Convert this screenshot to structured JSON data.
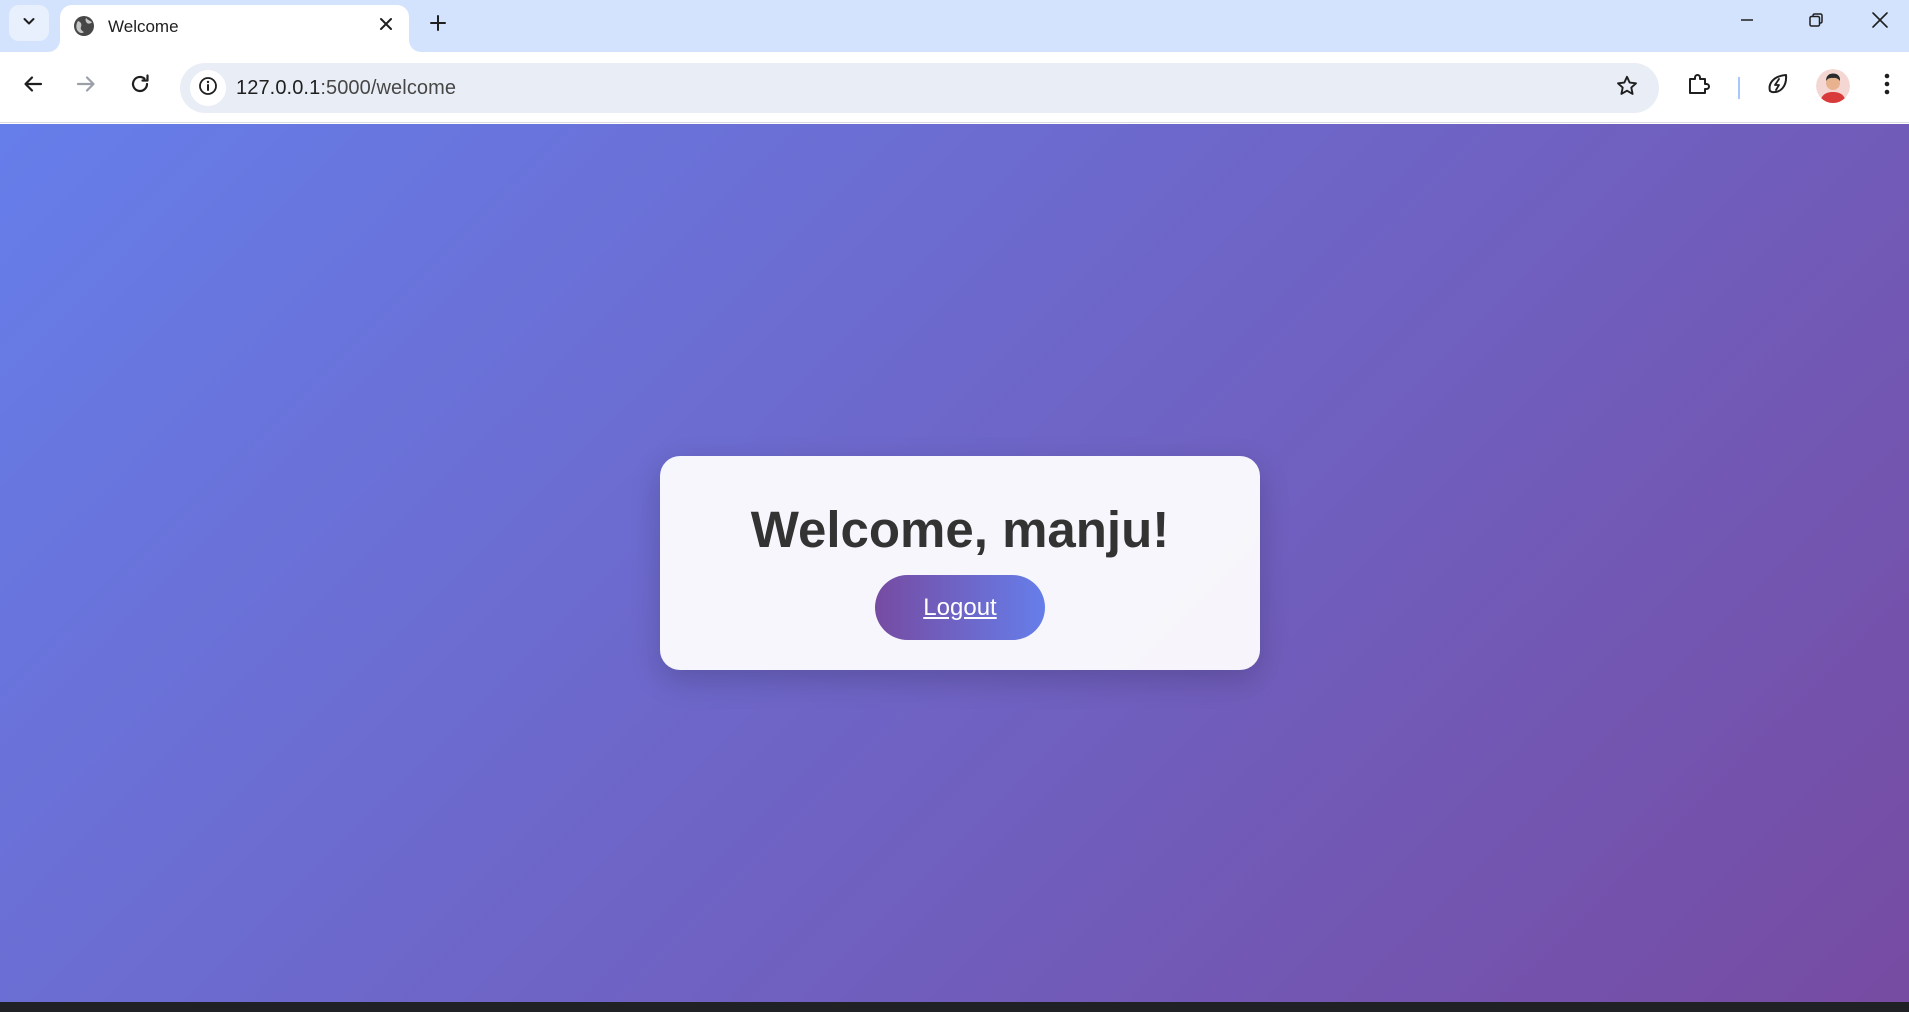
{
  "browser": {
    "tab": {
      "title": "Welcome",
      "favicon": "globe-icon"
    },
    "url": {
      "host": "127.0.0.1",
      "rest": ":5000/welcome"
    },
    "icons": {
      "tab_search": "chevron-down-icon",
      "close_tab": "close-icon",
      "new_tab": "plus-icon",
      "minimize": "minimize-icon",
      "restore": "restore-icon",
      "close_window": "close-icon",
      "back": "arrow-left-icon",
      "forward": "arrow-right-icon",
      "reload": "reload-icon",
      "site_info": "info-icon",
      "bookmark": "star-icon",
      "extensions": "puzzle-icon",
      "performance": "leaf-bolt-icon",
      "profile": "avatar",
      "menu": "kebab-menu-icon"
    }
  },
  "page": {
    "greeting": "Welcome, manju!",
    "logout_label": "Logout",
    "colors": {
      "gradient_start": "#667eea",
      "gradient_end": "#764ba2",
      "card_bg": "#f5f4f9",
      "title_color": "#333333"
    }
  }
}
